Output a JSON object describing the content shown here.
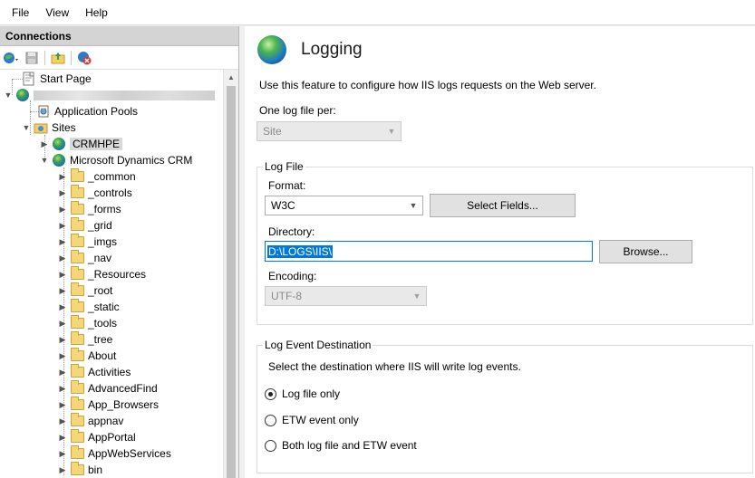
{
  "menu": {
    "file": "File",
    "view": "View",
    "help": "Help"
  },
  "connections": {
    "header": "Connections",
    "tree": {
      "start_page": "Start Page",
      "application_pools": "Application Pools",
      "sites": "Sites",
      "crmhpe": "CRMHPE",
      "dynamics": "Microsoft Dynamics CRM",
      "folders": [
        "_common",
        "_controls",
        "_forms",
        "_grid",
        "_imgs",
        "_nav",
        "_Resources",
        "_root",
        "_static",
        "_tools",
        "_tree",
        "About",
        "Activities",
        "AdvancedFind",
        "App_Browsers",
        "appnav",
        "AppPortal",
        "AppWebServices",
        "bin"
      ]
    }
  },
  "logging": {
    "title": "Logging",
    "description": "Use this feature to configure how IIS logs requests on the Web server.",
    "one_log_file_per_label": "One log file per:",
    "one_log_file_per_value": "Site",
    "log_file": {
      "group_label": "Log File",
      "format_label": "Format:",
      "format_value": "W3C",
      "select_fields_button": "Select Fields...",
      "directory_label": "Directory:",
      "directory_value": "D:\\LOGS\\IIS\\",
      "browse_button": "Browse...",
      "encoding_label": "Encoding:",
      "encoding_value": "UTF-8"
    },
    "log_event_destination": {
      "group_label": "Log Event Destination",
      "description": "Select the destination where IIS will write log events.",
      "options": [
        "Log file only",
        "ETW event only",
        "Both log file and ETW event"
      ],
      "selected": "Log file only"
    }
  }
}
